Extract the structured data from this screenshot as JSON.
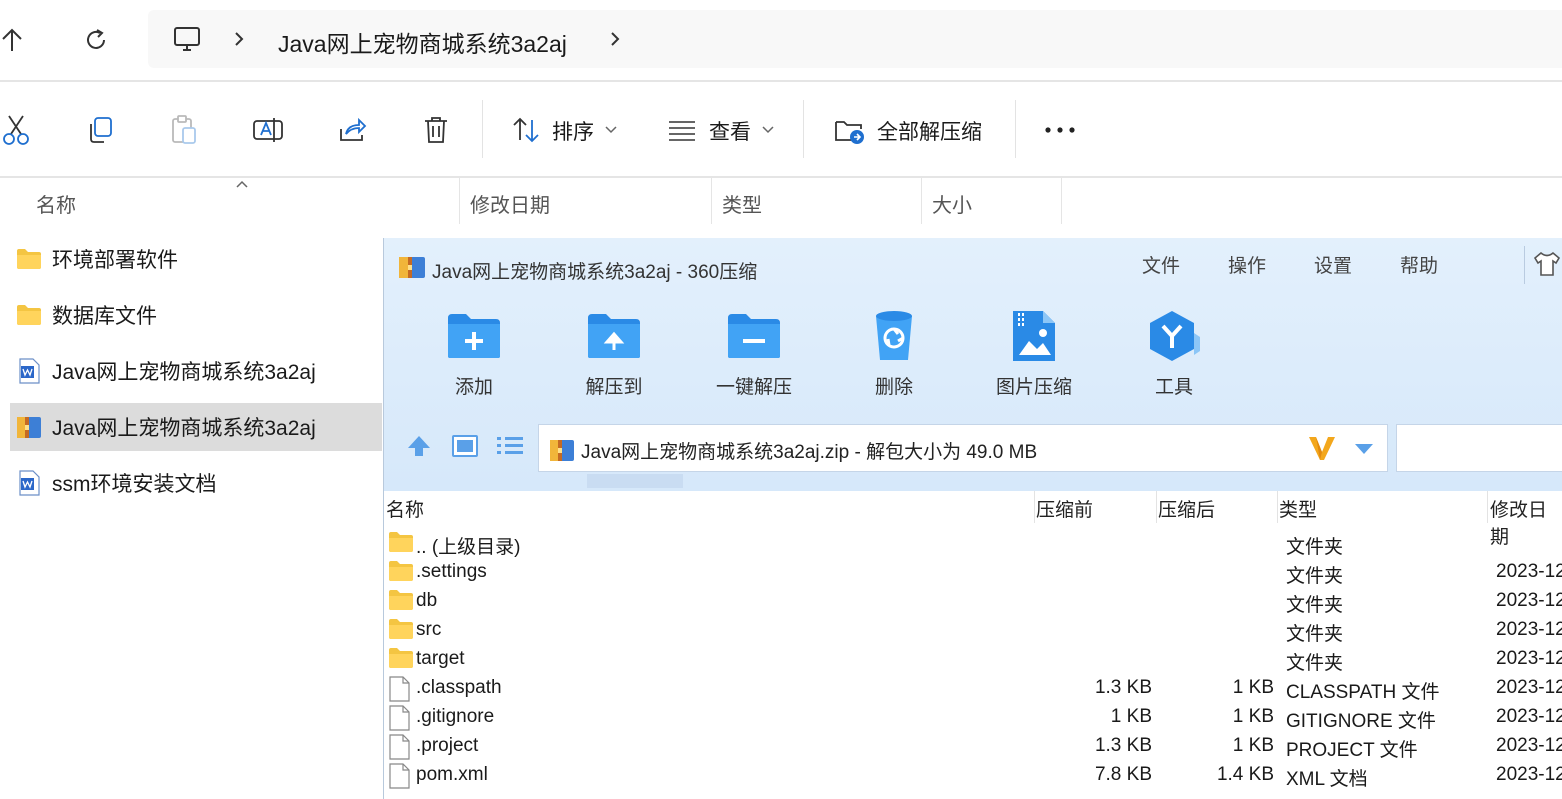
{
  "explorer": {
    "breadcrumb": "Java网上宠物商城系统3a2aj",
    "toolbar": {
      "sort_label": "排序",
      "view_label": "查看",
      "extract_all_label": "全部解压缩"
    },
    "columns": {
      "name": "名称",
      "modified": "修改日期",
      "type": "类型",
      "size": "大小"
    },
    "files": [
      {
        "name": "环境部署软件",
        "icon": "folder-icon"
      },
      {
        "name": "数据库文件",
        "icon": "folder-icon"
      },
      {
        "name": "Java网上宠物商城系统3a2aj",
        "icon": "word-doc-icon"
      },
      {
        "name": "Java网上宠物商城系统3a2aj",
        "icon": "zip-archive-icon"
      },
      {
        "name": "ssm环境安装文档",
        "icon": "word-doc-icon"
      }
    ]
  },
  "zip": {
    "title": "Java网上宠物商城系统3a2aj - 360压缩",
    "menu": {
      "file": "文件",
      "operate": "操作",
      "settings": "设置",
      "help": "帮助"
    },
    "buttons": {
      "add": "添加",
      "extract_to": "解压到",
      "one_click": "一键解压",
      "delete": "删除",
      "image_compress": "图片压缩",
      "tools": "工具"
    },
    "path_text": "Java网上宠物商城系统3a2aj.zip - 解包大小为 49.0 MB",
    "columns": {
      "name": "名称",
      "before": "压缩前",
      "after": "压缩后",
      "type": "类型",
      "modified": "修改日期"
    },
    "rows": [
      {
        "name": ".. (上级目录)",
        "before": "",
        "after": "",
        "type": "文件夹",
        "modified": ""
      },
      {
        "name": ".settings",
        "before": "",
        "after": "",
        "type": "文件夹",
        "modified": "2023-12"
      },
      {
        "name": "db",
        "before": "",
        "after": "",
        "type": "文件夹",
        "modified": "2023-12"
      },
      {
        "name": "src",
        "before": "",
        "after": "",
        "type": "文件夹",
        "modified": "2023-12"
      },
      {
        "name": "target",
        "before": "",
        "after": "",
        "type": "文件夹",
        "modified": "2023-12"
      },
      {
        "name": ".classpath",
        "before": "1.3 KB",
        "after": "1 KB",
        "type": "CLASSPATH 文件",
        "modified": "2023-12"
      },
      {
        "name": ".gitignore",
        "before": "1 KB",
        "after": "1 KB",
        "type": "GITIGNORE 文件",
        "modified": "2023-12"
      },
      {
        "name": ".project",
        "before": "1.3 KB",
        "after": "1 KB",
        "type": "PROJECT 文件",
        "modified": "2023-12"
      },
      {
        "name": "pom.xml",
        "before": "7.8 KB",
        "after": "1.4 KB",
        "type": "XML 文档",
        "modified": "2023-12"
      }
    ]
  }
}
